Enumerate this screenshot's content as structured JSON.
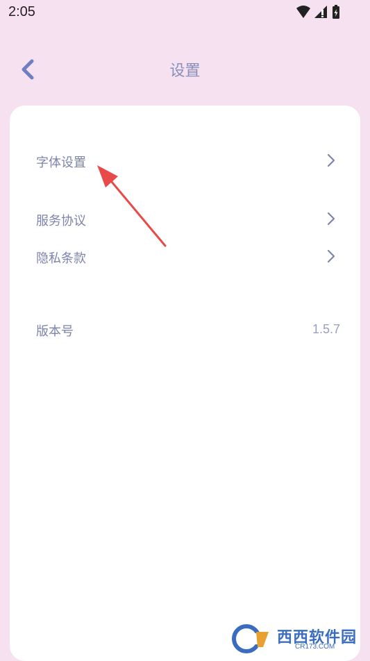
{
  "status_bar": {
    "time": "2:05",
    "icons": [
      "wifi-icon",
      "signal-icon",
      "battery-icon"
    ]
  },
  "header": {
    "title": "设置",
    "back_icon": "chevron-left-icon"
  },
  "settings": {
    "items": [
      {
        "label": "字体设置",
        "icon": "chevron-right-icon"
      },
      {
        "label": "服务协议",
        "icon": "chevron-right-icon"
      },
      {
        "label": "隐私条款",
        "icon": "chevron-right-icon"
      }
    ],
    "version": {
      "label": "版本号",
      "value": "1.5.7"
    }
  },
  "watermark": {
    "text": "西西软件园",
    "sub": "CR173.COM"
  },
  "colors": {
    "background": "#f6e1f1",
    "card": "#ffffff",
    "text": "#7d84ab",
    "accent": "#8790bb",
    "arrow": "#e84a4a"
  }
}
